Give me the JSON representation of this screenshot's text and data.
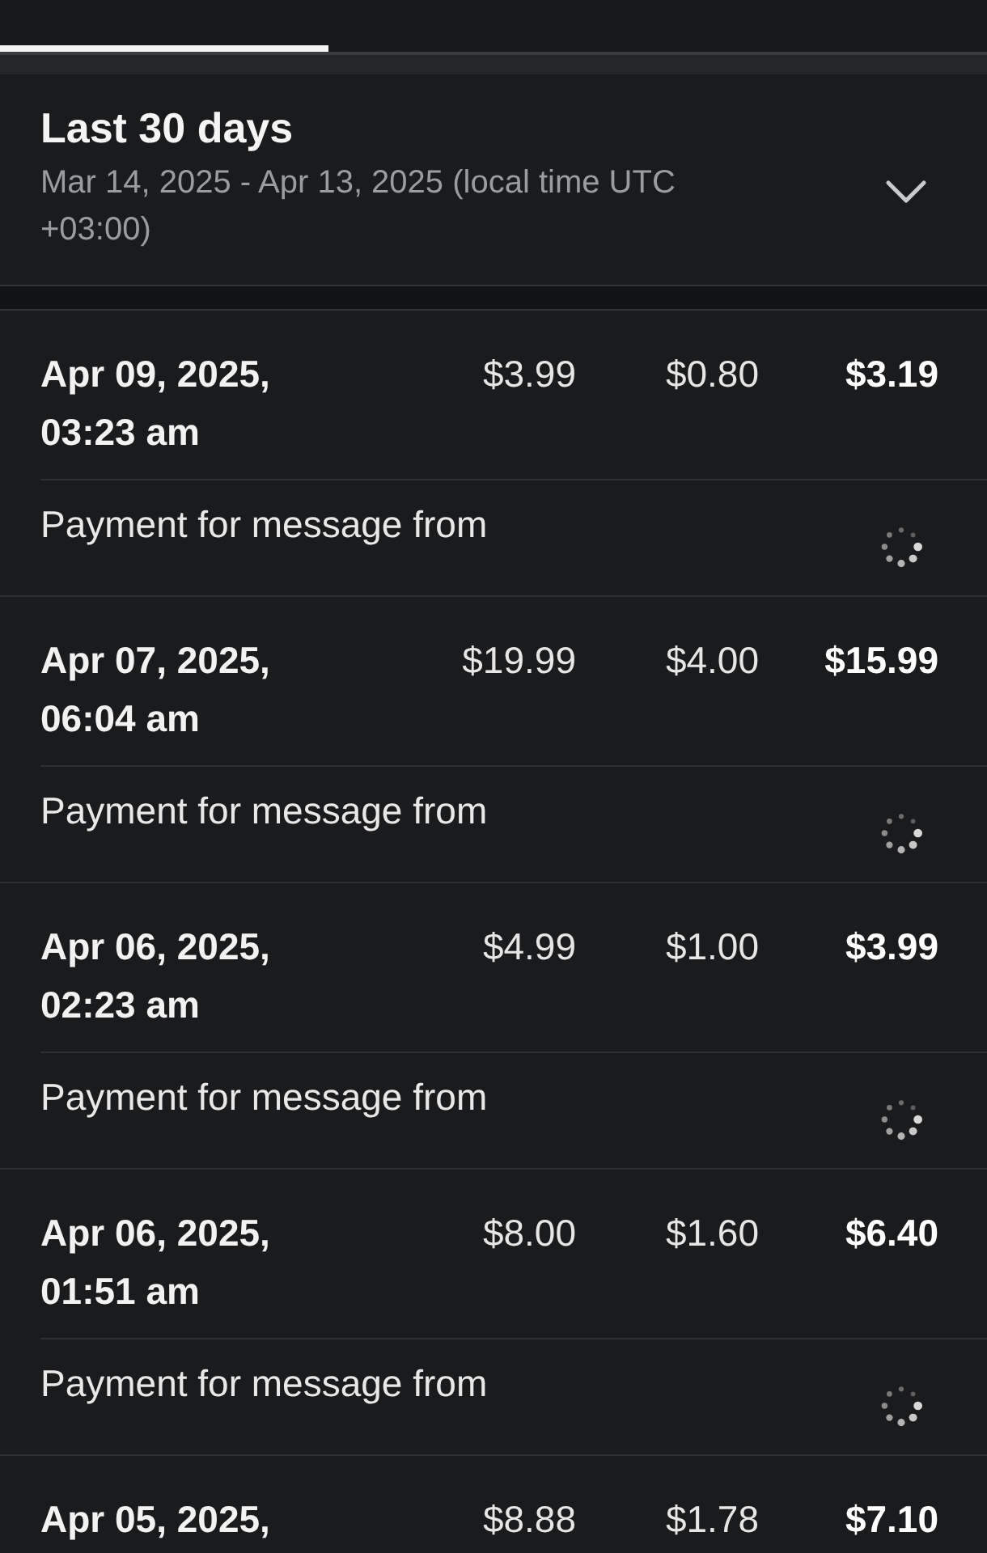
{
  "tabs": [
    {
      "selected": true
    },
    {
      "selected": false
    },
    {
      "selected": false
    }
  ],
  "period": {
    "title": "Last 30 days",
    "range": "Mar 14, 2025 - Apr 13, 2025 (local time UTC +03:00)"
  },
  "transactions": [
    {
      "date": "Apr 09, 2025,",
      "time": "03:23 am",
      "amounts": [
        "$3.99",
        "$0.80",
        "$3.19"
      ],
      "description": "Payment for message from"
    },
    {
      "date": "Apr 07, 2025,",
      "time": "06:04 am",
      "amounts": [
        "$19.99",
        "$4.00",
        "$15.99"
      ],
      "description": "Payment for message from"
    },
    {
      "date": "Apr 06, 2025,",
      "time": "02:23 am",
      "amounts": [
        "$4.99",
        "$1.00",
        "$3.99"
      ],
      "description": "Payment for message from"
    },
    {
      "date": "Apr 06, 2025,",
      "time": "01:51 am",
      "amounts": [
        "$8.00",
        "$1.60",
        "$6.40"
      ],
      "description": "Payment for message from"
    },
    {
      "date": "Apr 05, 2025,",
      "amounts": [
        "$8.88",
        "$1.78",
        "$7.10"
      ]
    }
  ]
}
